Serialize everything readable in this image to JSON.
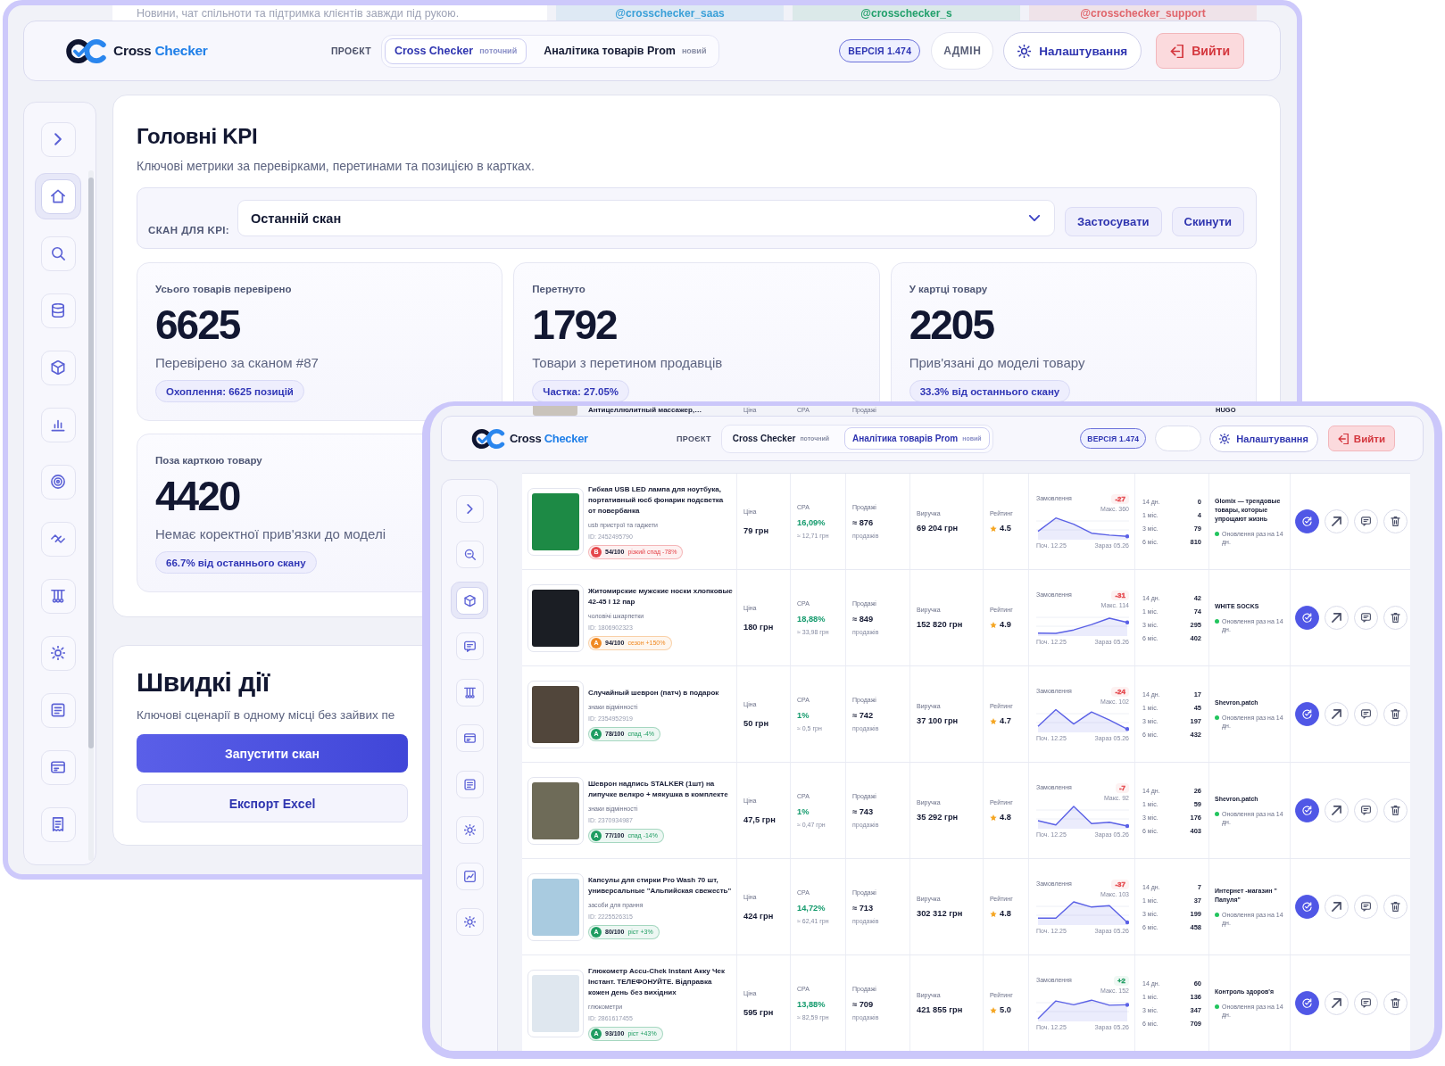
{
  "back_window": {
    "community": {
      "subtitle": "Новини, чат спільноти та підтримка клієнтів завжди під рукою.",
      "channels": [
        {
          "handle": "@crosschecker_saas",
          "color": "#3aa0d8"
        },
        {
          "handle": "@crosschecker_s",
          "color": "#22a06b"
        },
        {
          "handle": "@crosschecker_support",
          "color": "#e0656b"
        }
      ]
    },
    "header": {
      "logo_first": "Cross",
      "logo_second": "Checker",
      "project_label": "ПРОЄКТ",
      "projects": [
        {
          "name": "Cross Checker",
          "tag": "поточний",
          "selected": true
        },
        {
          "name": "Аналітика товарів Prom",
          "tag": "новий",
          "selected": false
        }
      ],
      "version": "ВЕРСІЯ 1.474",
      "role": "АДМІН",
      "settings": "Налаштування",
      "logout": "Вийти"
    },
    "sidebar": {
      "items": [
        {
          "selected": true
        },
        {
          "selected": false
        },
        {
          "selected": false
        },
        {
          "selected": false
        },
        {
          "selected": false
        },
        {
          "selected": false
        },
        {
          "selected": false
        },
        {
          "selected": false
        },
        {
          "selected": false
        },
        {
          "selected": false
        },
        {
          "selected": false
        },
        {
          "selected": false
        }
      ]
    },
    "kpi": {
      "title": "Головні KPI",
      "subtitle": "Ключові метрики за перевірками, перетинами та позицією в картках.",
      "filter": {
        "label": "СКАН ДЛЯ KPI:",
        "value": "Останній скан",
        "apply": "Застосувати",
        "reset": "Скинути"
      },
      "cards": [
        {
          "label": "Усього товарів перевірено",
          "value": "6625",
          "description": "Перевірено за сканом #87",
          "pill": "Охоплення: 6625 позицій"
        },
        {
          "label": "Перетнуто",
          "value": "1792",
          "description": "Товари з перетином продавців",
          "pill": "Частка: 27.05%"
        },
        {
          "label": "У картці товару",
          "value": "2205",
          "description": "Прив'язані до моделі товару",
          "pill": "33.3% від останнього скану"
        },
        {
          "label": "Поза карткою товару",
          "value": "4420",
          "description": "Немає коректної прив'язки до моделі",
          "pill": "66.7% від останнього скану"
        }
      ]
    },
    "quick_actions": {
      "title": "Швидкі дії",
      "subtitle": "Ключові сценарії в одному місці без зайвих пе",
      "buttons": [
        {
          "label": "Запустити скан",
          "kind": "primary"
        },
        {
          "label": "Експорт Excel",
          "kind": "secondary"
        }
      ]
    }
  },
  "front_window": {
    "peek_row": {
      "title": "Антицеллюлитный массажер,…",
      "labels": [
        "Ціна",
        "CPA",
        "Продажі"
      ],
      "seller": "HUGO"
    },
    "header": {
      "logo_first": "Cross",
      "logo_second": "Checker",
      "project_label": "ПРОЄКТ",
      "projects": [
        {
          "name": "Cross Checker",
          "tag": "поточний",
          "selected": false
        },
        {
          "name": "Аналітика товарів Prom",
          "tag": "новий",
          "selected": true
        }
      ],
      "version": "ВЕРСІЯ 1.474",
      "settings": "Налаштування",
      "logout": "Вийти"
    },
    "sidebar": {
      "items": [
        {
          "selected": false
        },
        {
          "selected": true
        },
        {
          "selected": false
        },
        {
          "selected": false
        },
        {
          "selected": false
        },
        {
          "selected": false
        },
        {
          "selected": false
        },
        {
          "selected": false
        },
        {
          "selected": false
        }
      ]
    },
    "table": {
      "rows": [
        {
          "title": "Гибкая USB LED лампа для ноутбука, портативный юсб фонарик подсветка от повербанка",
          "category": "usb пристрої та гаджети",
          "id": "ID: 2452495790",
          "score": {
            "grade": "B",
            "value": "54/100",
            "trend": "різкий спад -78%",
            "color": "#e5484d"
          },
          "price": {
            "label": "Ціна",
            "value": "79 грн"
          },
          "cpa": {
            "label": "CPA",
            "value": "16,09%",
            "sub": "≈ 12,71 грн"
          },
          "sales": {
            "label": "Продажі",
            "value": "≈ 876",
            "sub": "продажів"
          },
          "revenue": {
            "label": "Виручка",
            "value": "69 204 грн"
          },
          "rating": {
            "label": "Рейтинг",
            "value": "4.5"
          },
          "orders": {
            "label": "Замовлення",
            "delta": "-27",
            "color": "#e5484d",
            "max": "Макс. 360",
            "start": "Поч. 12.25",
            "end": "Зараз 05.26"
          },
          "periods": [
            {
              "label": "14 дн.",
              "value": "0"
            },
            {
              "label": "1 міс.",
              "value": "4"
            },
            {
              "label": "3 міс.",
              "value": "79"
            },
            {
              "label": "6 міс.",
              "value": "810"
            }
          ],
          "seller": {
            "name": "Glomix — трендовые товары, которые упрощают жизнь",
            "status": "Оновлення раз на 14 дн."
          }
        },
        {
          "title": "Житомирские мужские носки хлопковые 42-45 I 12 пар",
          "category": "чоловічі шкарпетки",
          "id": "ID: 1806902323",
          "score": {
            "grade": "A",
            "value": "94/100",
            "trend": "сезон +150%",
            "color": "#f08a24"
          },
          "price": {
            "label": "Ціна",
            "value": "180 грн"
          },
          "cpa": {
            "label": "CPA",
            "value": "18,88%",
            "sub": "≈ 33,98 грн"
          },
          "sales": {
            "label": "Продажі",
            "value": "≈ 849",
            "sub": "продажів"
          },
          "revenue": {
            "label": "Виручка",
            "value": "152 820 грн"
          },
          "rating": {
            "label": "Рейтинг",
            "value": "4.9"
          },
          "orders": {
            "label": "Замовлення",
            "delta": "-31",
            "color": "#e5484d",
            "max": "Макс. 114",
            "start": "Поч. 12.25",
            "end": "Зараз 05.26"
          },
          "periods": [
            {
              "label": "14 дн.",
              "value": "42"
            },
            {
              "label": "1 міс.",
              "value": "74"
            },
            {
              "label": "3 міс.",
              "value": "295"
            },
            {
              "label": "6 міс.",
              "value": "402"
            }
          ],
          "seller": {
            "name": "WHITE SOCKS",
            "status": "Оновлення раз на 14 дн."
          }
        },
        {
          "title": "Случайный шеврон (патч) в подарок",
          "category": "знаки відмінності",
          "id": "ID: 2354952919",
          "score": {
            "grade": "A",
            "value": "78/100",
            "trend": "спад -4%",
            "color": "#1f9d62"
          },
          "price": {
            "label": "Ціна",
            "value": "50 грн"
          },
          "cpa": {
            "label": "CPA",
            "value": "1%",
            "sub": "≈ 0,5 грн"
          },
          "sales": {
            "label": "Продажі",
            "value": "≈ 742",
            "sub": "продажів"
          },
          "revenue": {
            "label": "Виручка",
            "value": "37 100 грн"
          },
          "rating": {
            "label": "Рейтинг",
            "value": "4.7"
          },
          "orders": {
            "label": "Замовлення",
            "delta": "-24",
            "color": "#e5484d",
            "max": "Макс. 102",
            "start": "Поч. 12.25",
            "end": "Зараз 05.26"
          },
          "periods": [
            {
              "label": "14 дн.",
              "value": "17"
            },
            {
              "label": "1 міс.",
              "value": "45"
            },
            {
              "label": "3 міс.",
              "value": "197"
            },
            {
              "label": "6 міс.",
              "value": "432"
            }
          ],
          "seller": {
            "name": "Shevron.patch",
            "status": "Оновлення раз на 14 дн."
          }
        },
        {
          "title": "Шеврон надпись STALKER (1шт) на липучке велкро + мякушка в комплекте",
          "category": "знаки відмінності",
          "id": "ID: 2370934987",
          "score": {
            "grade": "A",
            "value": "77/100",
            "trend": "спад -14%",
            "color": "#1f9d62"
          },
          "price": {
            "label": "Ціна",
            "value": "47,5 грн"
          },
          "cpa": {
            "label": "CPA",
            "value": "1%",
            "sub": "≈ 0,47 грн"
          },
          "sales": {
            "label": "Продажі",
            "value": "≈ 743",
            "sub": "продажів"
          },
          "revenue": {
            "label": "Виручка",
            "value": "35 292 грн"
          },
          "rating": {
            "label": "Рейтинг",
            "value": "4.8"
          },
          "orders": {
            "label": "Замовлення",
            "delta": "-7",
            "color": "#e5484d",
            "max": "Макс. 92",
            "start": "Поч. 12.25",
            "end": "Зараз 05.26"
          },
          "periods": [
            {
              "label": "14 дн.",
              "value": "26"
            },
            {
              "label": "1 міс.",
              "value": "59"
            },
            {
              "label": "3 міс.",
              "value": "176"
            },
            {
              "label": "6 міс.",
              "value": "403"
            }
          ],
          "seller": {
            "name": "Shevron.patch",
            "status": "Оновлення раз на 14 дн."
          }
        },
        {
          "title": "Капсулы для стирки Pro Wash 70 шт, универсальные \"Альпийская свежесть\"",
          "category": "засоби для прання",
          "id": "ID: 2225526315",
          "score": {
            "grade": "A",
            "value": "80/100",
            "trend": "ріст +3%",
            "color": "#1f9d62"
          },
          "price": {
            "label": "Ціна",
            "value": "424 грн"
          },
          "cpa": {
            "label": "CPA",
            "value": "14,72%",
            "sub": "≈ 62,41 грн"
          },
          "sales": {
            "label": "Продажі",
            "value": "≈ 713",
            "sub": "продажів"
          },
          "revenue": {
            "label": "Виручка",
            "value": "302 312 грн"
          },
          "rating": {
            "label": "Рейтинг",
            "value": "4.8"
          },
          "orders": {
            "label": "Замовлення",
            "delta": "-37",
            "color": "#e5484d",
            "max": "Макс. 103",
            "start": "Поч. 12.25",
            "end": "Зараз 05.26"
          },
          "periods": [
            {
              "label": "14 дн.",
              "value": "7"
            },
            {
              "label": "1 міс.",
              "value": "37"
            },
            {
              "label": "3 міс.",
              "value": "199"
            },
            {
              "label": "6 міс.",
              "value": "458"
            }
          ],
          "seller": {
            "name": "Интернет -магазин \" Папуля\"",
            "status": "Оновлення раз на 14 дн."
          }
        },
        {
          "title": "Глюкометр Accu-Chek Instant Акку Чек Інстант. ТЕЛЕФОНУЙТЕ. Відправка кожен день без вихідних",
          "category": "глюкометри",
          "id": "ID: 2861617455",
          "score": {
            "grade": "A",
            "value": "93/100",
            "trend": "ріст +43%",
            "color": "#1f9d62"
          },
          "price": {
            "label": "Ціна",
            "value": "595 грн"
          },
          "cpa": {
            "label": "CPA",
            "value": "13,88%",
            "sub": "≈ 82,59 грн"
          },
          "sales": {
            "label": "Продажі",
            "value": "≈ 709",
            "sub": "продажів"
          },
          "revenue": {
            "label": "Виручка",
            "value": "421 855 грн"
          },
          "rating": {
            "label": "Рейтинг",
            "value": "5.0"
          },
          "orders": {
            "label": "Замовлення",
            "delta": "+2",
            "color": "#1f9d62",
            "max": "Макс. 152",
            "start": "Поч. 12.25",
            "end": "Зараз 05.26"
          },
          "periods": [
            {
              "label": "14 дн.",
              "value": "60"
            },
            {
              "label": "1 міс.",
              "value": "136"
            },
            {
              "label": "3 міс.",
              "value": "347"
            },
            {
              "label": "6 міс.",
              "value": "709"
            }
          ],
          "seller": {
            "name": "Контроль здоров'я",
            "status": "Оновлення раз на 14 дн."
          }
        }
      ]
    }
  }
}
